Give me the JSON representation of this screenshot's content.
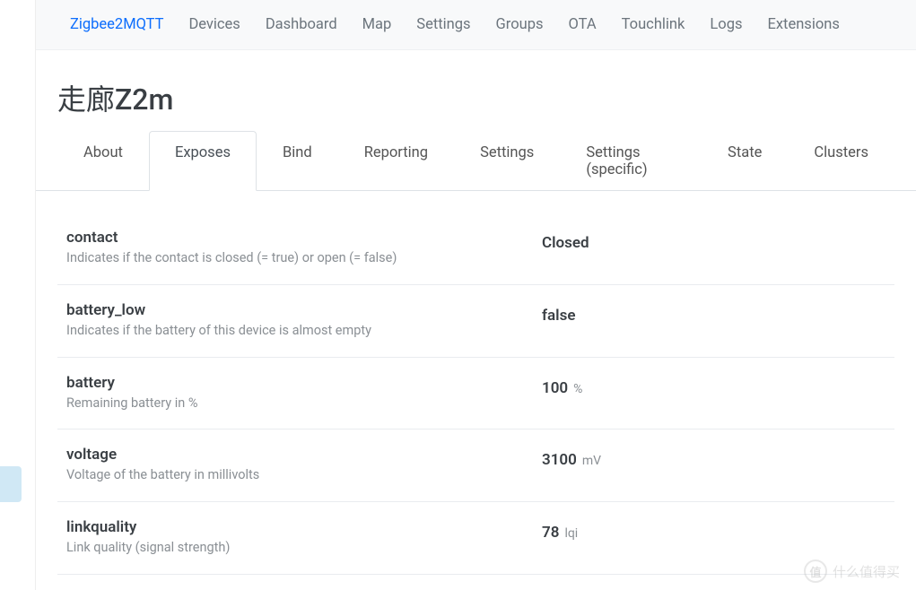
{
  "nav": {
    "brand": "Zigbee2MQTT",
    "items": [
      "Devices",
      "Dashboard",
      "Map",
      "Settings",
      "Groups",
      "OTA",
      "Touchlink",
      "Logs",
      "Extensions"
    ]
  },
  "page": {
    "title": "走廊Z2m"
  },
  "tabs": {
    "items": [
      "About",
      "Exposes",
      "Bind",
      "Reporting",
      "Settings",
      "Settings (specific)",
      "State",
      "Clusters"
    ],
    "activeIndex": 1
  },
  "exposes": [
    {
      "name": "contact",
      "description": "Indicates if the contact is closed (= true) or open (= false)",
      "value": "Closed",
      "unit": ""
    },
    {
      "name": "battery_low",
      "description": "Indicates if the battery of this device is almost empty",
      "value": "false",
      "unit": ""
    },
    {
      "name": "battery",
      "description": "Remaining battery in %",
      "value": "100",
      "unit": "%"
    },
    {
      "name": "voltage",
      "description": "Voltage of the battery in millivolts",
      "value": "3100",
      "unit": "mV"
    },
    {
      "name": "linkquality",
      "description": "Link quality (signal strength)",
      "value": "78",
      "unit": "lqi"
    }
  ],
  "watermark": {
    "badge": "值",
    "text": "什么值得买"
  }
}
